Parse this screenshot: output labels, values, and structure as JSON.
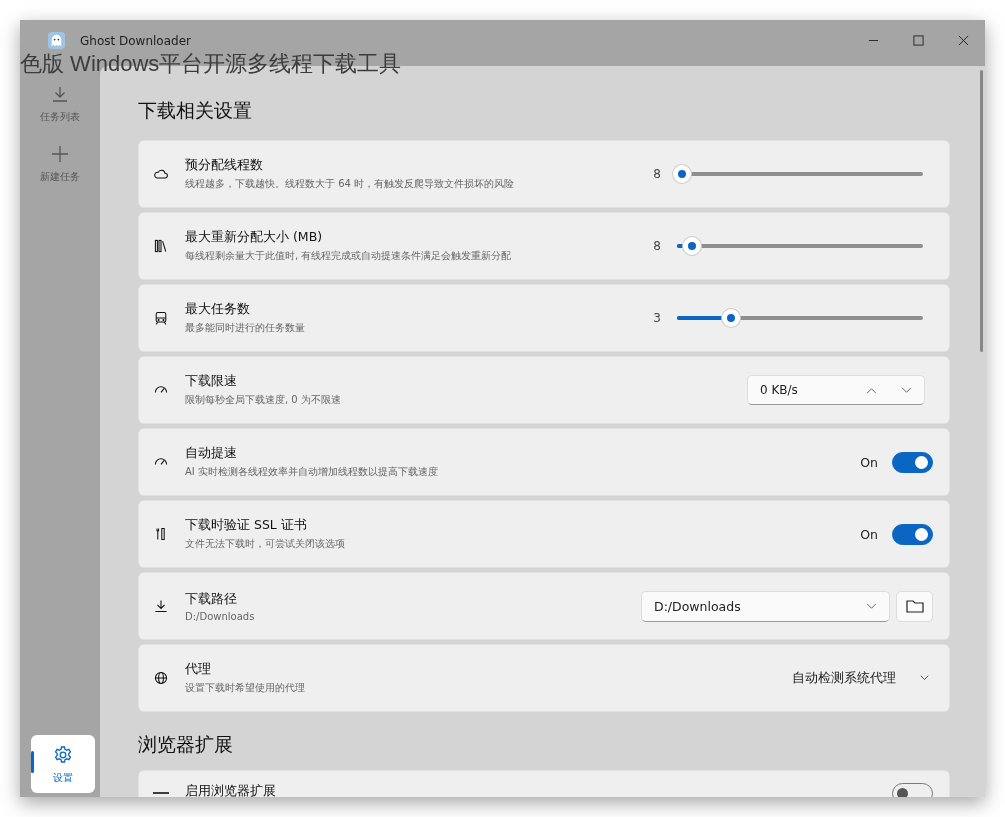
{
  "window": {
    "title": "Ghost Downloader"
  },
  "background_text": "色版 Windows平台开源多线程下载工具",
  "sidebar": {
    "items": [
      {
        "label": "任务列表",
        "selected": false
      },
      {
        "label": "新建任务",
        "selected": false
      }
    ],
    "bottom_item": {
      "label": "设置",
      "selected": true
    }
  },
  "sections": [
    {
      "title": "下载相关设置",
      "cards": [
        {
          "kind": "slider",
          "title": "预分配线程数",
          "description": "线程越多，下载越快。线程数大于 64 时，有触发反爬导致文件损坏的风险",
          "value": "8",
          "level": 0.02
        },
        {
          "kind": "slider",
          "title": "最大重新分配大小 (MB)",
          "description": "每线程剩余量大于此值时, 有线程完成或自动提速条件满足会触发重新分配",
          "value": "8",
          "level": 0.06
        },
        {
          "kind": "slider",
          "title": "最大任务数",
          "description": "最多能同时进行的任务数量",
          "value": "3",
          "level": 0.22
        },
        {
          "kind": "spinbox",
          "title": "下载限速",
          "description": "限制每秒全局下载速度, 0 为不限速",
          "value": "0 KB/s"
        },
        {
          "kind": "switch",
          "title": "自动提速",
          "description": "AI 实时检测各线程效率并自动增加线程数以提高下载速度",
          "state_label": "On",
          "on": true
        },
        {
          "kind": "switch",
          "title": "下载时验证 SSL 证书",
          "description": "文件无法下载时，可尝试关闭该选项",
          "state_label": "On",
          "on": true
        },
        {
          "kind": "folder",
          "title": "下载路径",
          "description": "D:/Downloads",
          "value": "D:/Downloads"
        },
        {
          "kind": "dropdown",
          "title": "代理",
          "description": "设置下载时希望使用的代理",
          "value": "自动检测系统代理"
        }
      ]
    },
    {
      "title": "浏览器扩展",
      "cards": [
        {
          "kind": "switch",
          "title": "启用浏览器扩展",
          "on": false
        }
      ]
    }
  ]
}
